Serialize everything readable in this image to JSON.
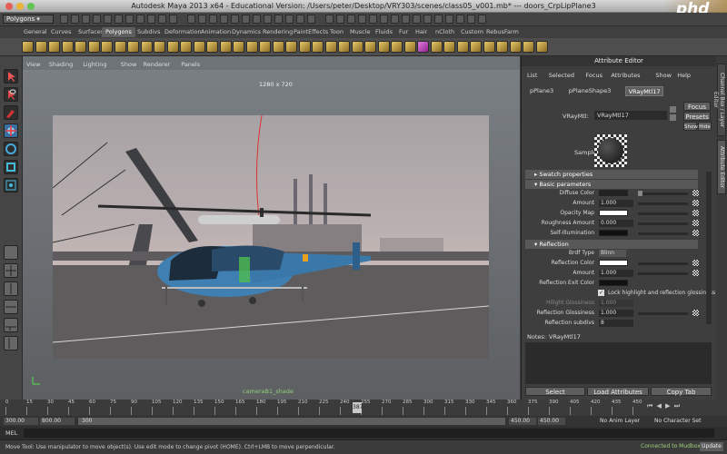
{
  "window": {
    "title": "Autodesk Maya 2013 x64 - Educational Version: /Users/peter/Desktop/VRY303/scenes/class05_v001.mb* --- doors_CrpLipPlane3"
  },
  "status_line": {
    "mode": "Polygons"
  },
  "shelf_tabs": [
    "General",
    "Curves",
    "Surfaces",
    "Polygons",
    "Subdivs",
    "Deformation",
    "Animation",
    "Dynamics",
    "Rendering",
    "PaintEffects",
    "Toon",
    "Muscle",
    "Fluids",
    "Fur",
    "Hair",
    "nCloth",
    "Custom",
    "RebusFarm"
  ],
  "shelf_active_tab": "Polygons",
  "viewport": {
    "menu": [
      "View",
      "Shading",
      "Lighting",
      "Show",
      "Renderer",
      "Panels"
    ],
    "resolution": "1280 x 720",
    "camera": "cameraB1_shade"
  },
  "attr_editor": {
    "title": "Attribute Editor",
    "menu": [
      "List",
      "Selected",
      "Focus",
      "Attributes",
      "Show",
      "Help"
    ],
    "node_tabs": [
      "pPlane3",
      "pPlaneShape3",
      "VRayMtl17"
    ],
    "active_node_tab": "VRayMtl17",
    "node_label": "VRayMtl:",
    "node_value": "VRayMtl17",
    "buttons": {
      "focus": "Focus",
      "presets": "Presets",
      "show": "Show",
      "hide": "Hide"
    },
    "sample_label": "Sample",
    "sections": {
      "swatch": "Swatch properties",
      "basic": "Basic parameters",
      "reflection": "Reflection"
    },
    "basic": {
      "diffuse_color": "Diffuse Color",
      "amount": "Amount",
      "amount_val": "1.000",
      "opacity_map": "Opacity Map",
      "roughness_amount": "Roughness Amount",
      "roughness_val": "0.000",
      "self_illum": "Self-Illumination"
    },
    "reflection": {
      "brdf_type": "Brdf Type",
      "brdf_val": "Blinn",
      "reflection_color": "Reflection Color",
      "amount": "Amount",
      "amount_val": "1.000",
      "exit_color": "Reflection Exit Color",
      "lock_label": "Lock highlight and reflection glossiness",
      "highlight_gloss": "Hilight Glossiness",
      "highlight_val": "1.000",
      "refl_gloss": "Reflection Glossiness",
      "refl_gloss_val": "1.000",
      "subdivs": "Reflection subdivs",
      "subdivs_val": "8"
    },
    "notes_label": "Notes:",
    "notes_value": "VRayMtl17",
    "bottom_buttons": {
      "select": "Select",
      "load": "Load Attributes",
      "copy": "Copy Tab"
    }
  },
  "side_tabs": [
    "Channel Box / Layer Editor",
    "Attribute Editor"
  ],
  "timeline": {
    "ticks": [
      "0",
      "15",
      "30",
      "45",
      "60",
      "75",
      "90",
      "105",
      "120",
      "135",
      "150",
      "165",
      "180",
      "195",
      "210",
      "225",
      "240",
      "255",
      "270",
      "285",
      "300",
      "315",
      "330",
      "345",
      "360",
      "375",
      "390",
      "405",
      "420",
      "435",
      "450"
    ],
    "current_frame": "387",
    "range_start": "300.00",
    "range_start2": "800.00",
    "playback_start": "300",
    "range_end": "450.00",
    "range_end2": "450.00",
    "anim_layer": "No Anim Layer",
    "char_set": "No Character Set"
  },
  "command_line": {
    "label": "MEL"
  },
  "help_line": {
    "text": "Move Tool: Use manipulator to move object(s). Use edit mode to change pivot (HOME). Ctrl+LMB to move perpendicular.",
    "mudbox": "Connected to Mudbox",
    "update": "Update"
  },
  "logo": {
    "text": "phd"
  },
  "colors": {
    "accent": "#4aa3df",
    "viewport_bg": "#6e7378",
    "panel_bg": "#3e3e3e"
  }
}
